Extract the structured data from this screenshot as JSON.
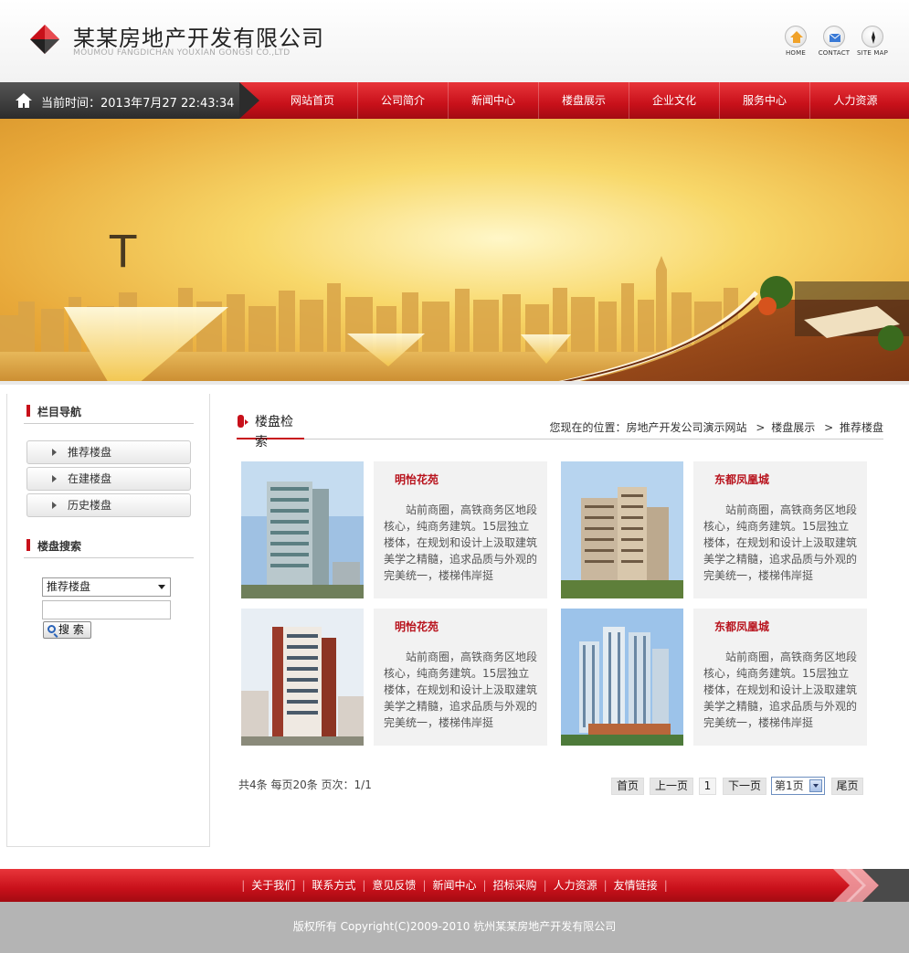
{
  "header": {
    "company_name": "某某房地产开发有限公司",
    "company_sub": "MOUMOU FANGDICHAN YOUXIAN GONGSI CO.,LTD",
    "icons": [
      {
        "label": "HOME",
        "icon": "home-icon"
      },
      {
        "label": "CONTACT",
        "icon": "mail-icon"
      },
      {
        "label": "SITE MAP",
        "icon": "compass-icon"
      }
    ]
  },
  "nav": {
    "time_text": "当前时间：2013年7月27 22:43:34",
    "items": [
      "网站首页",
      "公司简介",
      "新闻中心",
      "楼盘展示",
      "企业文化",
      "服务中心",
      "人力资源"
    ]
  },
  "banner": {
    "letter": "T"
  },
  "sidebar": {
    "nav_title": "栏目导航",
    "nav_items": [
      "推荐楼盘",
      "在建楼盘",
      "历史楼盘"
    ],
    "search_title": "楼盘搜索",
    "search_select": "推荐楼盘",
    "search_button": "搜 索"
  },
  "main": {
    "title": "楼盘检索",
    "breadcrumb": {
      "prefix": "您现在的位置：房地产开发公司演示网站",
      "level1": "楼盘展示",
      "level2": "推荐楼盘",
      "sep": ">"
    },
    "cards": [
      {
        "name": "明怡花苑",
        "desc": "站前商圈，高铁商务区地段核心，纯商务建筑。15层独立楼体，在规划和设计上汲取建筑美学之精髓，追求品质与外观的完美统一，楼梯伟岸挺"
      },
      {
        "name": "东都凤凰城",
        "desc": "站前商圈，高铁商务区地段核心，纯商务建筑。15层独立楼体，在规划和设计上汲取建筑美学之精髓，追求品质与外观的完美统一，楼梯伟岸挺"
      },
      {
        "name": "明怡花苑",
        "desc": "站前商圈，高铁商务区地段核心，纯商务建筑。15层独立楼体，在规划和设计上汲取建筑美学之精髓，追求品质与外观的完美统一，楼梯伟岸挺"
      },
      {
        "name": "东都凤凰城",
        "desc": "站前商圈，高铁商务区地段核心，纯商务建筑。15层独立楼体，在规划和设计上汲取建筑美学之精髓，追求品质与外观的完美统一，楼梯伟岸挺"
      }
    ],
    "pagination": {
      "info": "共4条  每页20条  页次：1/1",
      "first": "首页",
      "prev": "上一页",
      "current": "1",
      "next": "下一页",
      "select": "第1页",
      "last": "尾页"
    }
  },
  "footer": {
    "links": [
      "关于我们",
      "联系方式",
      "意见反馈",
      "新闻中心",
      "招标采购",
      "人力资源",
      "友情链接"
    ],
    "link_sep": "|",
    "copyright": "版权所有  Copyright(C)2009-2010 杭州某某房地产开发有限公司"
  },
  "colors": {
    "brand_red": "#c8101a",
    "dark_gray": "#2c2c2c",
    "footer_gray": "#b4b4b4"
  }
}
